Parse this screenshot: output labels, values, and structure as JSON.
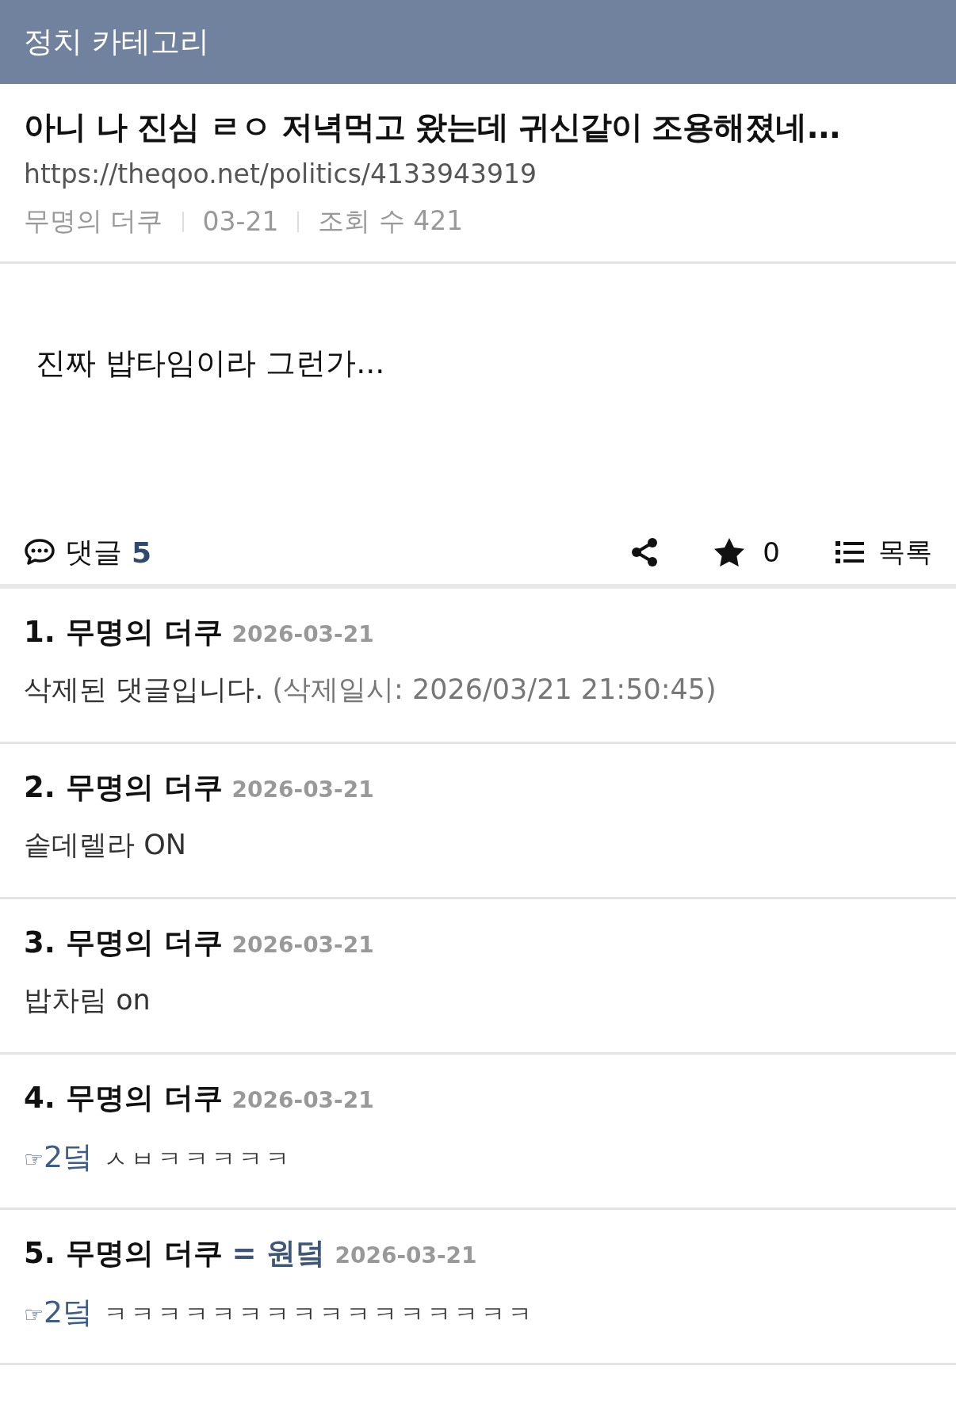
{
  "header": {
    "title": "정치 카테고리"
  },
  "post": {
    "title": "아니 나 진심 ㄹㅇ 저녁먹고 왔는데 귀신같이 조용해졌네...",
    "url": "https://theqoo.net/politics/4133943919",
    "author": "무명의 더쿠",
    "date": "03-21",
    "views": "조회 수 421",
    "body": "진짜 밥타임이라 그런가..."
  },
  "actions": {
    "comments_label": "댓글",
    "comment_count": "5",
    "likes": "0",
    "list_label": "목록"
  },
  "comments": [
    {
      "kind": "deleted",
      "author": "1. 무명의 더쿠",
      "date": "2026-03-21",
      "text": "삭제된 댓글입니다.",
      "note": "(삭제일시: 2026/03/21 21:50:45)"
    },
    {
      "kind": "plain",
      "author": "2. 무명의 더쿠",
      "date": "2026-03-21",
      "text": "솥데렐라 ON"
    },
    {
      "kind": "plain",
      "author": "3. 무명의 더쿠",
      "date": "2026-03-21",
      "text": "밥차림 on"
    },
    {
      "kind": "reply",
      "author": "4. 무명의 더쿠",
      "date": "2026-03-21",
      "pointer": "☞",
      "reply_to": "2덬",
      "text": "ㅅㅂㅋㅋㅋㅋㅋ"
    },
    {
      "kind": "reply",
      "author": "5. 무명의 더쿠",
      "op_tag": "= 원덬",
      "date": "2026-03-21",
      "pointer": "☞",
      "reply_to": "2덬",
      "text": "ㅋㅋㅋㅋㅋㅋㅋㅋㅋㅋㅋㅋㅋㅋㅋㅋ"
    }
  ]
}
